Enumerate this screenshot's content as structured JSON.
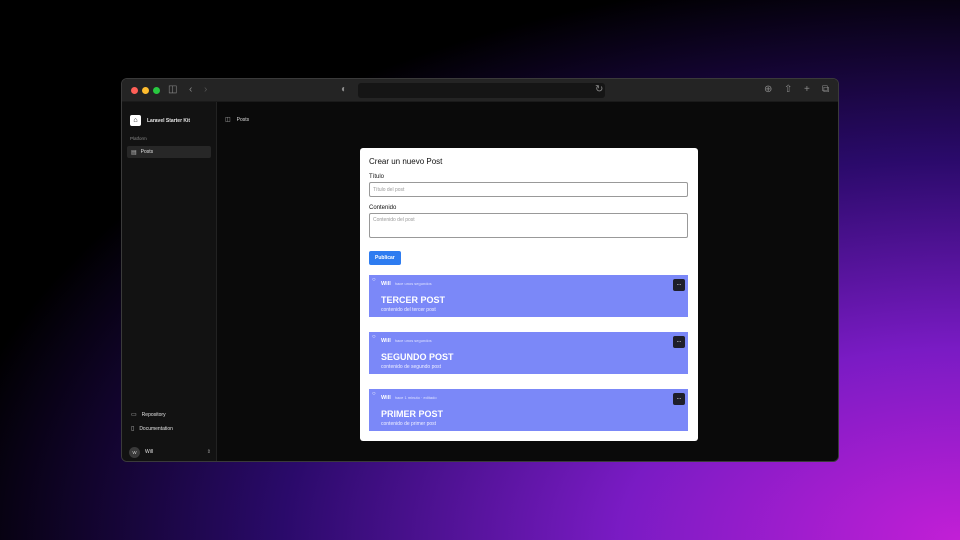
{
  "sidebar": {
    "app_name": "Laravel Starter Kit",
    "section_label": "Platform",
    "nav_items": [
      {
        "label": "Posts",
        "icon": "posts-icon"
      }
    ],
    "footer_links": [
      {
        "label": "Repository",
        "icon": "folder-icon"
      },
      {
        "label": "Documentation",
        "icon": "book-icon"
      }
    ],
    "user": {
      "initials": "W",
      "name": "Will"
    }
  },
  "breadcrumb": {
    "label": "Posts"
  },
  "form": {
    "title": "Crear un nuevo Post",
    "title_label": "Título",
    "title_placeholder": "Título del post",
    "content_label": "Contenido",
    "content_placeholder": "Contenido del post",
    "publish_label": "Publicar"
  },
  "posts": [
    {
      "author": "Will",
      "time": "hace unos segundos",
      "title": "TERCER POST",
      "body": "contenido del tercer post",
      "menu": "..."
    },
    {
      "author": "Will",
      "time": "hace unos segundos",
      "title": "SEGUNDO POST",
      "body": "contenido de segundo post",
      "menu": "..."
    },
    {
      "author": "Will",
      "time": "hace 1 minuto · editado",
      "title": "PRIMER POST",
      "body": "contenido de primer post",
      "menu": "..."
    }
  ],
  "colors": {
    "accent": "#2e7cf0",
    "post_bg": "#7b88f8",
    "traffic": [
      "#ff5f57",
      "#febc2e",
      "#28c840"
    ]
  }
}
